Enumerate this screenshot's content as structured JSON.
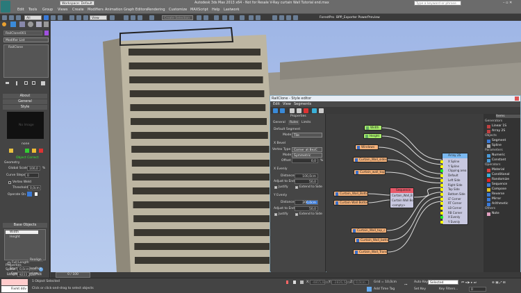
{
  "app": {
    "title": "Autodesk 3ds Max 2013 x64 - Not for Resale  V-Ray curtain Wall Tutorial end.max",
    "workspace": "Workspace: Default",
    "search_placeholder": "Type a keyword or phrase"
  },
  "menu": [
    "Edit",
    "Tools",
    "Group",
    "Views",
    "Create",
    "Modifiers",
    "Animation",
    "Graph Editors",
    "Rendering",
    "Customize",
    "MAXScript",
    "Help",
    "Lastwork"
  ],
  "toolbar": {
    "filter": "All",
    "ref_coord": "View",
    "selection_set": "Create Selection Se",
    "plugins": [
      "ForestPro",
      "BPP_Exporter PowerPreview"
    ]
  },
  "command_panel": {
    "object_name": "RailClone001",
    "object_color": "#a050e0",
    "modifier_list": "Modifier List",
    "stack": [
      "RailClone"
    ],
    "rollouts": {
      "about": "About",
      "general": "General",
      "style": "Style"
    },
    "style_preview": "No Image",
    "style_name": "none",
    "object_status": "Object Correct",
    "geometry": {
      "title": "Geometry",
      "global_scale_label": "Global Scale",
      "global_scale": "100,0",
      "pct": "%",
      "curve_steps_label": "Curve Steps",
      "curve_steps": "0",
      "vertex_weld_label": "Vertex Weld",
      "threshold_label": "Threshold",
      "threshold": "0,0cm",
      "operate_on_label": "Operate On"
    },
    "base_objects": {
      "title": "Base Objects",
      "items": [
        "Width",
        "Height"
      ]
    },
    "properties": {
      "title": "Properties",
      "spline_label": "Spline",
      "clear": "Clear",
      "spline_name": "Creaenl_baseline",
      "full_length": "Full Length",
      "realign": "Realign",
      "start_label": "Start",
      "start": "0,0cm",
      "length_label": "Length",
      "length": "8222,2cm",
      "pick": "Pick"
    }
  },
  "timeline": {
    "frame": "0 / 100"
  },
  "status": {
    "maxscript": "Fixmt  ddv",
    "selected": "1 Object Selected",
    "prompt": "Click or click-and-drag to select objects",
    "x": "-4815,0cm",
    "y": "-2826,5cm",
    "z": "0,0cm",
    "grid": "Grid = 10,0cm",
    "add_time_tag": "Add Time Tag",
    "auto_key": "Auto Key",
    "key_mode": "Selected",
    "set_key": "Set Key",
    "key_filters": "Key Filters...",
    "frame": "0"
  },
  "editor": {
    "title": "RailClone - Style editor",
    "menu": [
      "Edit",
      "View",
      "Segments"
    ],
    "properties_title": "Properties",
    "tabs": [
      "General",
      "Rules",
      "Limits"
    ],
    "default_segment": {
      "title": "Default Segment",
      "mode_label": "Mode",
      "mode": "Tile"
    },
    "x_bevel": {
      "title": "X Bevel",
      "vertex_type_label": "Vertex Type",
      "vertex_type": "Corner at BezC",
      "mode_label": "Mode",
      "mode": "Symmetric",
      "offset_label": "Offset",
      "offset": "0,0",
      "pct": "%"
    },
    "x_evenly": {
      "title": "X Evenly",
      "distance_label": "Distance",
      "distance": "100,0cm",
      "adjust_label": "Adjust to End",
      "adjust": "50,0",
      "justify": "Justify",
      "extend": "Extend to Side"
    },
    "y_evenly": {
      "title": "Y Evenly",
      "distance_label": "Distance",
      "distance": "200,0cm",
      "adjust_label": "Adjust to End",
      "adjust": "50,0",
      "justify": "Justify",
      "extend": "Extend to Side"
    },
    "nodes": [
      "Width",
      "Height",
      "Windows",
      "Curtain_Wall_sides",
      "Curtain_wall_top",
      "Curtain_Wall_Botto",
      "Curtain Wall Botton",
      "Curtain_Wall_top_c",
      "Curtain_Wall_botto",
      "Curtain_Wall_Trans"
    ],
    "sequence": {
      "title": "Sequence",
      "inputs": [
        "Curtain_Wall_B",
        "Curtain Wall Bo",
        "<empty>"
      ]
    },
    "array": {
      "title": "Array 2S",
      "inputs": [
        "X Spline",
        "Y Spline",
        "Clipping area",
        "Default",
        "Left Side",
        "Right Side",
        "Top Side",
        "Bottom Side",
        "LT Corner",
        "RT Corner",
        "LB Corner",
        "RB Corner",
        "X Evenly",
        "Y Evenly"
      ]
    },
    "items_title": "Items",
    "items": [
      {
        "cat": "Generators"
      },
      {
        "name": "Linear 1S",
        "color": "#c04040"
      },
      {
        "name": "Array 2S",
        "color": "#c04040"
      },
      {
        "cat": "Objects"
      },
      {
        "name": "Segment",
        "color": "#3a7ad8"
      },
      {
        "name": "Spline",
        "color": "#aaaaaa"
      },
      {
        "cat": "Parameters"
      },
      {
        "name": "Numeric",
        "color": "#4a9ad8"
      },
      {
        "name": "Constant",
        "color": "#4a9ad8"
      },
      {
        "cat": "Operators"
      },
      {
        "name": "Material",
        "color": "#d84040"
      },
      {
        "name": "Conditional",
        "color": "#3ab0d8"
      },
      {
        "name": "Randomize",
        "color": "#e02020"
      },
      {
        "name": "Sequence",
        "color": "#3a7ad8"
      },
      {
        "name": "Compose",
        "color": "#e0c020"
      },
      {
        "name": "Reverse",
        "color": "#3a7ad8"
      },
      {
        "name": "Mirror",
        "color": "#3a7ad8"
      },
      {
        "name": "Arithmetic",
        "color": "#3a7ad8"
      },
      {
        "cat": "Others"
      },
      {
        "name": "Note",
        "color": "#e0a0c0"
      }
    ]
  }
}
